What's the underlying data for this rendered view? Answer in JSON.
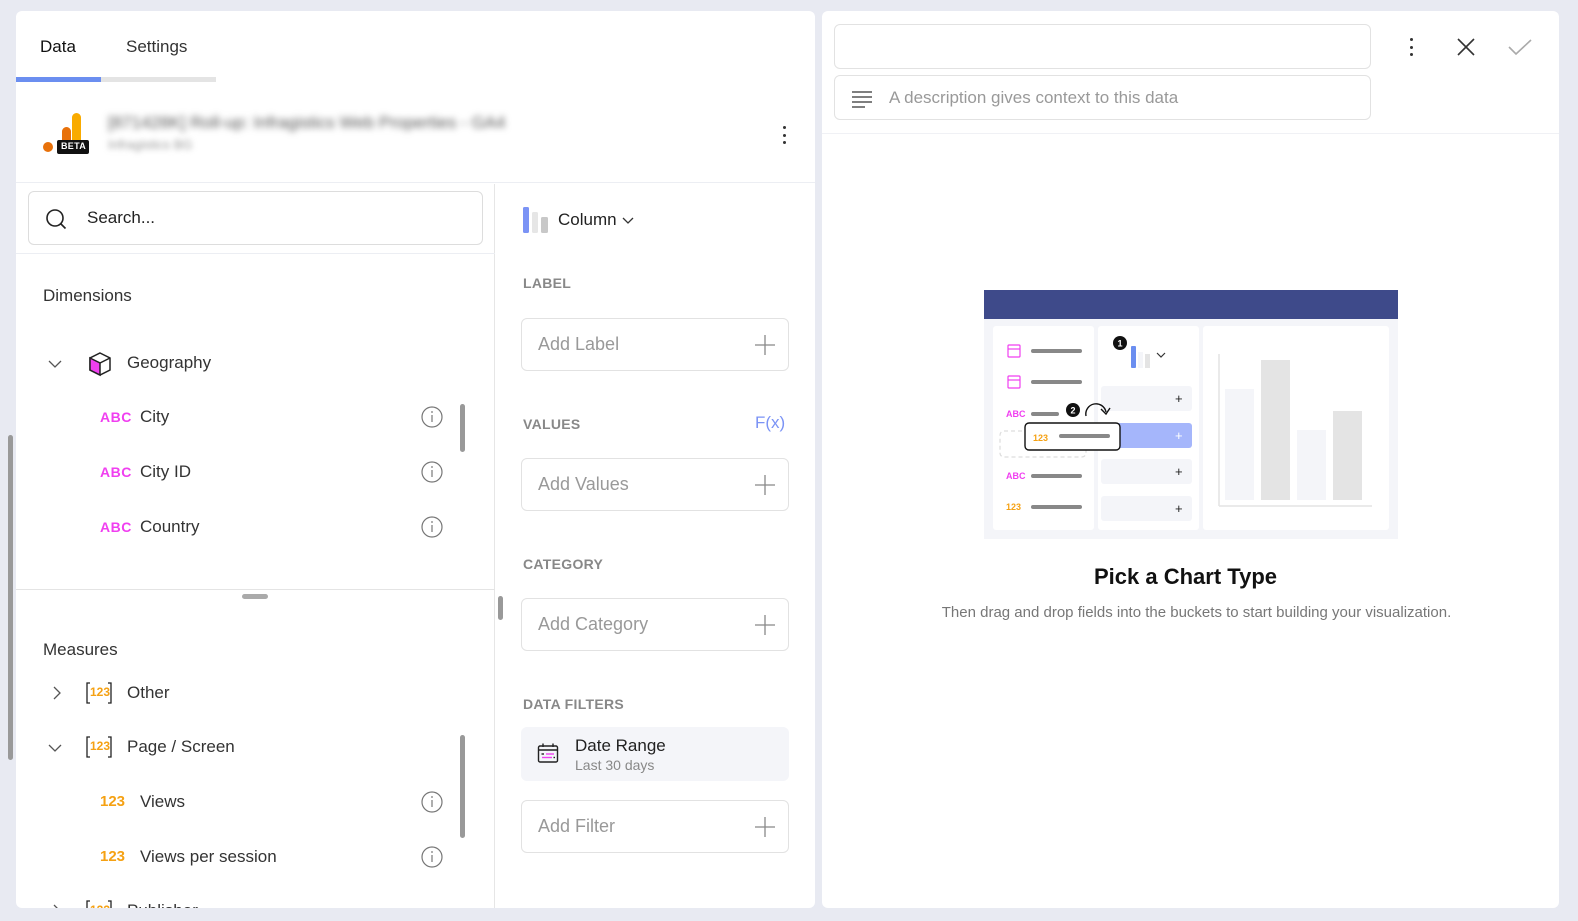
{
  "tabs": [
    {
      "label": "Data",
      "active": true
    },
    {
      "label": "Settings",
      "active": false
    }
  ],
  "datasource": {
    "title": "[871428K] Roll-up: Infragistics Web Properties - GA4",
    "subtitle": "Infragistics BG",
    "badge": "BETA",
    "logo_icon": "google-analytics-icon"
  },
  "search": {
    "placeholder": "Search...",
    "value": ""
  },
  "dimensions": {
    "title": "Dimensions",
    "groups": [
      {
        "label": "Geography",
        "icon": "cube-icon",
        "expanded": true,
        "fields": [
          {
            "type": "ABC",
            "label": "City"
          },
          {
            "type": "ABC",
            "label": "City ID"
          },
          {
            "type": "ABC",
            "label": "Country"
          }
        ]
      }
    ]
  },
  "measures": {
    "title": "Measures",
    "groups": [
      {
        "label": "Other",
        "type": "123",
        "expanded": false,
        "fields": []
      },
      {
        "label": "Page / Screen",
        "type": "123",
        "expanded": true,
        "fields": [
          {
            "type": "123",
            "label": "Views"
          },
          {
            "type": "123",
            "label": "Views per session"
          }
        ]
      },
      {
        "label": "Publisher",
        "type": "123",
        "expanded": false,
        "fields": []
      }
    ]
  },
  "buckets": {
    "chart_type": "Column",
    "fx_label": "F(x)",
    "sections": [
      {
        "title": "LABEL",
        "placeholder": "Add Label"
      },
      {
        "title": "VALUES",
        "placeholder": "Add Values"
      },
      {
        "title": "CATEGORY",
        "placeholder": "Add Category"
      },
      {
        "title": "DATA FILTERS",
        "placeholder": "Add Filter"
      }
    ],
    "date_filter": {
      "title": "Date Range",
      "value": "Last 30 days"
    }
  },
  "editor": {
    "title_value": "",
    "description_placeholder": "A description gives context to this data"
  },
  "empty_state": {
    "title": "Pick a Chart Type",
    "subtitle": "Then drag and drop fields into the buckets to start building your visualization.",
    "illustration": {
      "step_badges": [
        "1",
        "2"
      ],
      "field_types": [
        "date",
        "date",
        "ABC",
        "123",
        "ABC",
        "123"
      ],
      "dragged_field_type": "123"
    }
  },
  "colors": {
    "accent": "#6b8ef0",
    "dimension_type": "#f03ff0",
    "measure_type": "#f5a113",
    "illustration_header": "#3e4a8a"
  }
}
